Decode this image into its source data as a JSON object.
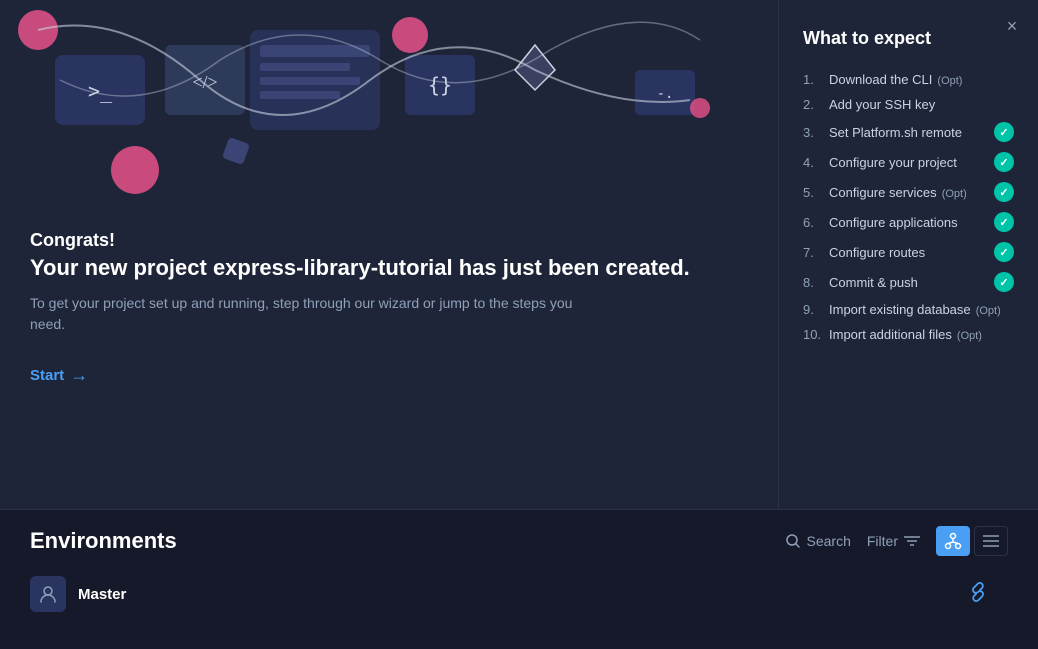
{
  "illustration": {
    "alt": "Code editor and developer tools illustration"
  },
  "congrats": {
    "label": "Congrats!",
    "title": "Your new project express-library-tutorial has just been created.",
    "description": "To get your project set up and running, step through our wizard or jump to the steps you need.",
    "start_label": "Start"
  },
  "sidebar": {
    "title": "What to expect",
    "close_label": "×",
    "steps": [
      {
        "number": "1.",
        "label": "Download the CLI",
        "opt": "(Opt)",
        "checked": false
      },
      {
        "number": "2.",
        "label": "Add your SSH key",
        "opt": "",
        "checked": false
      },
      {
        "number": "3.",
        "label": "Set Platform.sh remote",
        "opt": "",
        "checked": true
      },
      {
        "number": "4.",
        "label": "Configure your project",
        "opt": "",
        "checked": true
      },
      {
        "number": "5.",
        "label": "Configure services",
        "opt": "(Opt)",
        "checked": true
      },
      {
        "number": "6.",
        "label": "Configure applications",
        "opt": "",
        "checked": true
      },
      {
        "number": "7.",
        "label": "Configure routes",
        "opt": "",
        "checked": true
      },
      {
        "number": "8.",
        "label": "Commit & push",
        "opt": "",
        "checked": true
      },
      {
        "number": "9.",
        "label": "Import existing database",
        "opt": "(Opt)",
        "checked": false
      },
      {
        "number": "10.",
        "label": "Import additional files",
        "opt": "(Opt)",
        "checked": false
      }
    ]
  },
  "environments": {
    "title": "Environments",
    "search_label": "Search",
    "filter_label": "Filter",
    "master": {
      "name": "Master",
      "avatar": "👤"
    }
  },
  "colors": {
    "accent": "#4a9ff5",
    "check": "#00c4a7",
    "bg_dark": "#16192a",
    "bg_panel": "#1e2538"
  }
}
